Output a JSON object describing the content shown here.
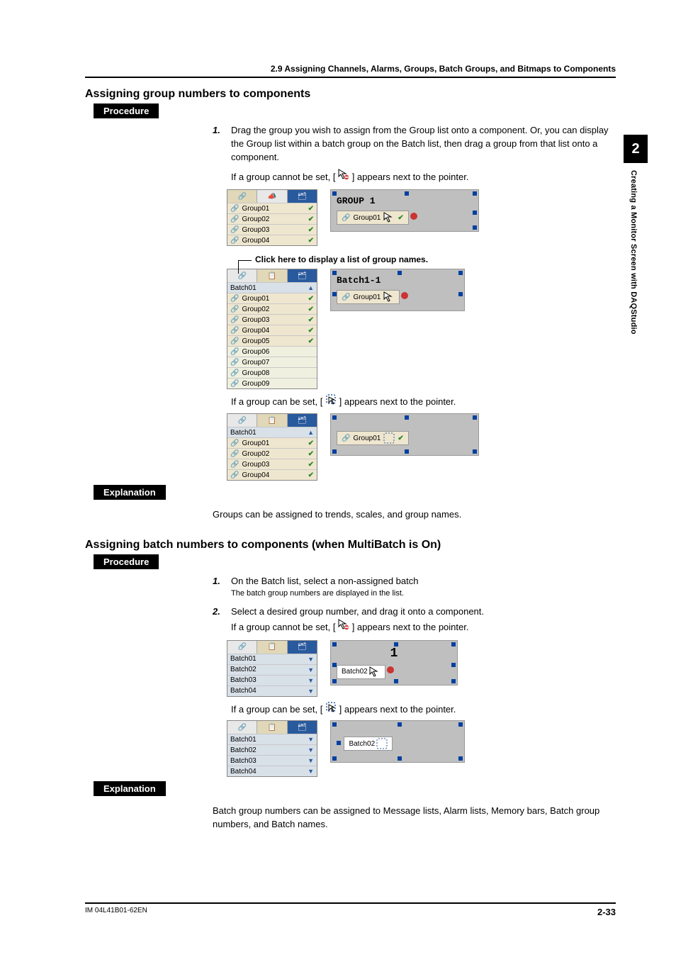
{
  "header": {
    "section": "2.9  Assigning Channels, Alarms, Groups, Batch Groups, and Bitmaps to Components"
  },
  "tab": {
    "chapter": "2",
    "side_label": "Creating a Monitor Screen with DAQStudio"
  },
  "s1": {
    "title": "Assigning group numbers to components",
    "procedure_label": "Procedure",
    "step1_num": "1.",
    "step1_text": "Drag the group you wish to assign from the Group list onto a component. Or, you can display the Group list within a batch group on the Batch list, then drag a group from that list onto a component.",
    "cannot_set": "If a group cannot be set, [",
    "cannot_set_tail": "] appears next to the pointer.",
    "click_caption": "Click here to display a list of group names.",
    "can_set": "If a group can be set, [",
    "can_set_tail": "] appears next to the pointer.",
    "explanation_label": "Explanation",
    "explanation_text": "Groups can be assigned to trends, scales, and group names."
  },
  "s2": {
    "title": "Assigning batch numbers to components (when MultiBatch is On)",
    "procedure_label": "Procedure",
    "step1_num": "1.",
    "step1_text": "On the Batch list, select a non-assigned batch",
    "step1_sub": "The batch group numbers are displayed in the list.",
    "step2_num": "2.",
    "step2_text": "Select a desired group number, and drag it onto a component.",
    "cannot_set": "If a group cannot be set, [",
    "cannot_set_tail": "] appears next to the pointer.",
    "can_set": "If a group can be set, [",
    "can_set_tail": "] appears next to the pointer.",
    "explanation_label": "Explanation",
    "explanation_text": "Batch group numbers can be assigned to Message lists, Alarm lists, Memory bars, Batch group numbers, and Batch names."
  },
  "panels": {
    "groups4": [
      "Group01",
      "Group02",
      "Group03",
      "Group04"
    ],
    "groups9": [
      "Group01",
      "Group02",
      "Group03",
      "Group04",
      "Group05",
      "Group06",
      "Group07",
      "Group08",
      "Group09"
    ],
    "batch01": "Batch01",
    "batch_list4": [
      "Batch01",
      "Batch02",
      "Batch03",
      "Batch04"
    ],
    "canvas_group1": "GROUP 1",
    "canvas_group01_chip": "Group01",
    "canvas_batch11": "Batch1-1",
    "canvas_one": "1",
    "canvas_batch02": "Batch02"
  },
  "icons": {
    "forbid": "forbid-icon",
    "allow": "allow-icon"
  },
  "footer": {
    "doc_id": "IM 04L41B01-62EN",
    "page": "2-33"
  }
}
